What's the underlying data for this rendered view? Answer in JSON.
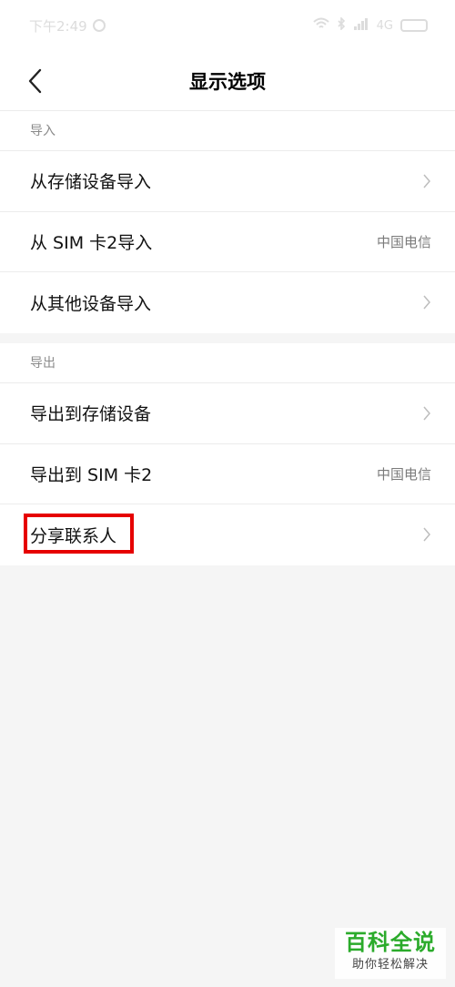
{
  "status_bar": {
    "time": "下午2:49",
    "network": "4G",
    "battery": "29"
  },
  "header": {
    "title": "显示选项"
  },
  "import_section": {
    "label": "导入",
    "items": [
      {
        "label": "从存储设备导入",
        "value": ""
      },
      {
        "label": "从 SIM 卡2导入",
        "value": "中国电信"
      },
      {
        "label": "从其他设备导入",
        "value": ""
      }
    ]
  },
  "export_section": {
    "label": "导出",
    "items": [
      {
        "label": "导出到存储设备",
        "value": ""
      },
      {
        "label": "导出到 SIM 卡2",
        "value": "中国电信"
      },
      {
        "label": "分享联系人",
        "value": ""
      }
    ]
  },
  "watermark": {
    "title": "百科全说",
    "subtitle": "助你轻松解决"
  },
  "colors": {
    "highlight": "#e60000",
    "watermark_green": "#2bab2b"
  }
}
